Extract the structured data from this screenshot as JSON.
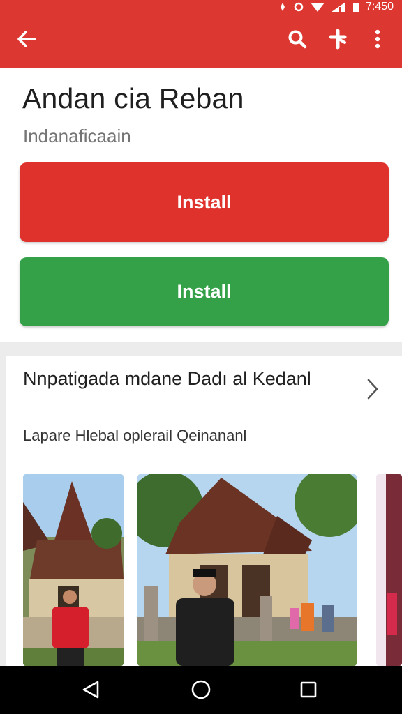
{
  "status_bar": {
    "time": "7:450"
  },
  "toolbar": {
    "back_label": "Back",
    "search_label": "Search",
    "pin_label": "Pin",
    "more_label": "More options"
  },
  "app": {
    "title": "Andan cia Reban",
    "subtitle": "Indanaficaain",
    "install_primary": "Install",
    "install_secondary": "Install"
  },
  "section": {
    "title": "Nnpatigada mdane Dadı al Kedanl",
    "subtitle": "Lapare Hlebal oplerail Qeinananl"
  },
  "colors": {
    "accent_red": "#dd3731",
    "button_red": "#e0322c",
    "button_green": "#34a048"
  },
  "icons": [
    "arrow-back-icon",
    "search-icon",
    "pin-icon",
    "more-vert-icon",
    "chevron-right-icon",
    "nav-back-icon",
    "nav-home-icon",
    "nav-recents-icon"
  ]
}
